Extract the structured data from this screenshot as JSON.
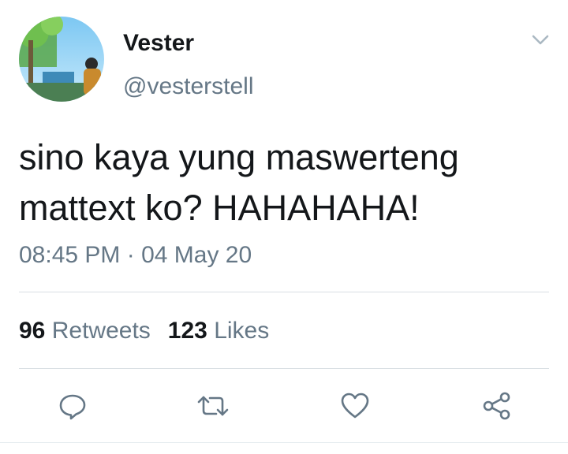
{
  "author": {
    "display_name": "Vester",
    "handle": "@vesterstell"
  },
  "tweet": {
    "lines": [
      "sino kaya yung maswerteng",
      "mattext ko? HAHAHAHA!"
    ],
    "timestamp": "08:45 PM · 04 May 20"
  },
  "stats": {
    "retweets_count": "96",
    "retweets_label": "Retweets",
    "likes_count": "123",
    "likes_label": "Likes"
  },
  "icons": {
    "menu": "chevron-down-icon",
    "reply": "reply-icon",
    "retweet": "retweet-icon",
    "like": "heart-icon",
    "share": "share-icon"
  },
  "colors": {
    "text": "#14171a",
    "secondary": "#657786",
    "divider": "#d9dfe3"
  }
}
